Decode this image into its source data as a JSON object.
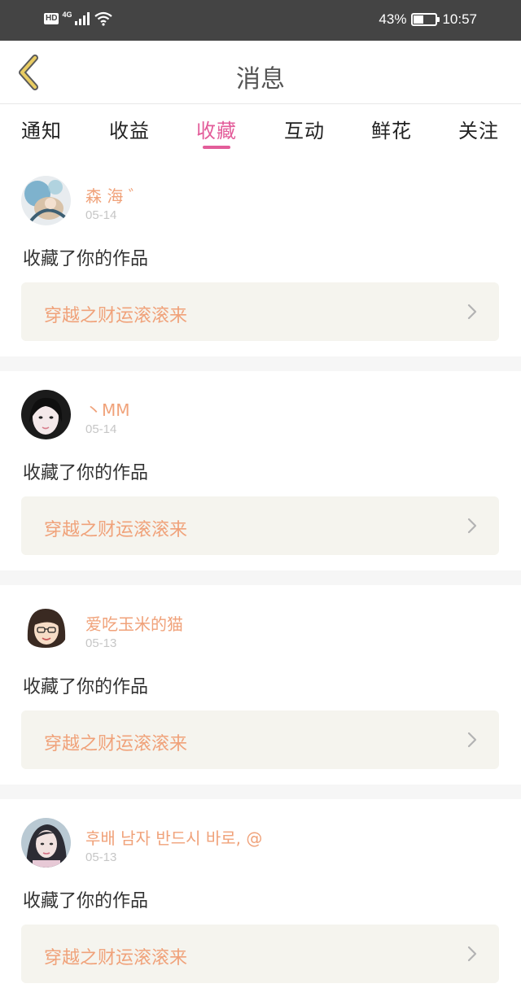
{
  "status_bar": {
    "hd_label": "HD",
    "network_label": "4G",
    "battery_text": "43%",
    "battery_level": 0.43,
    "time": "10:57"
  },
  "header": {
    "title": "消息"
  },
  "tabs": [
    {
      "label": "通知",
      "active": false
    },
    {
      "label": "收益",
      "active": false
    },
    {
      "label": "收藏",
      "active": true
    },
    {
      "label": "互动",
      "active": false
    },
    {
      "label": "鲜花",
      "active": false
    },
    {
      "label": "关注",
      "active": false
    }
  ],
  "colors": {
    "accent": "#e35d9a",
    "name": "#f0a27a",
    "status_bar": "#444444",
    "card_bg": "#f5f4ee"
  },
  "items": [
    {
      "name": "森 海 ゛",
      "date": "05-14",
      "action": "收藏了你的作品",
      "work_title": "穿越之财运滚滚来"
    },
    {
      "name": "丶MM",
      "date": "05-14",
      "action": "收藏了你的作品",
      "work_title": "穿越之财运滚滚来"
    },
    {
      "name": "爱吃玉米的猫",
      "date": "05-13",
      "action": "收藏了你的作品",
      "work_title": "穿越之财运滚滚来"
    },
    {
      "name": "후배 남자 반드시 바로, @",
      "date": "05-13",
      "action": "收藏了你的作品",
      "work_title": "穿越之财运滚滚来"
    }
  ]
}
